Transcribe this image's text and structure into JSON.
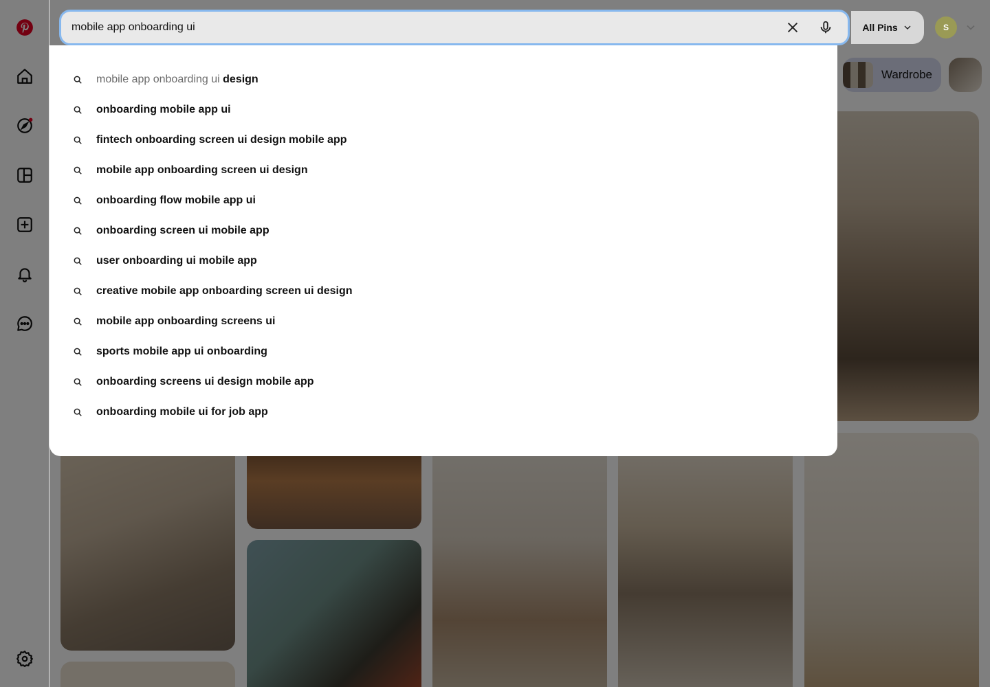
{
  "search": {
    "value": "mobile app onboarding ui",
    "filter_label": "All Pins"
  },
  "account": {
    "avatar_initial": "S"
  },
  "chips": [
    {
      "label": "Wardrobe"
    }
  ],
  "suggestions": {
    "first": {
      "prefix": "mobile app onboarding ui",
      "completion": "design"
    },
    "items": [
      "onboarding mobile app ui",
      "fintech onboarding screen ui design mobile app",
      "mobile app onboarding screen ui design",
      "onboarding flow mobile app ui",
      "onboarding screen ui mobile app",
      "user onboarding ui mobile app",
      "creative mobile app onboarding screen ui design",
      "mobile app onboarding screens ui",
      "sports mobile app ui onboarding",
      "onboarding screens ui design mobile app",
      "onboarding mobile ui for job app"
    ]
  },
  "colors": {
    "brand": "#e60023",
    "focus_ring": "#87b8ee",
    "notification_dot": "#e60023"
  },
  "sidebar_icons": [
    "pinterest-logo",
    "home-icon",
    "explore-icon",
    "boards-icon",
    "create-icon",
    "notifications-icon",
    "messages-icon",
    "settings-icon"
  ]
}
